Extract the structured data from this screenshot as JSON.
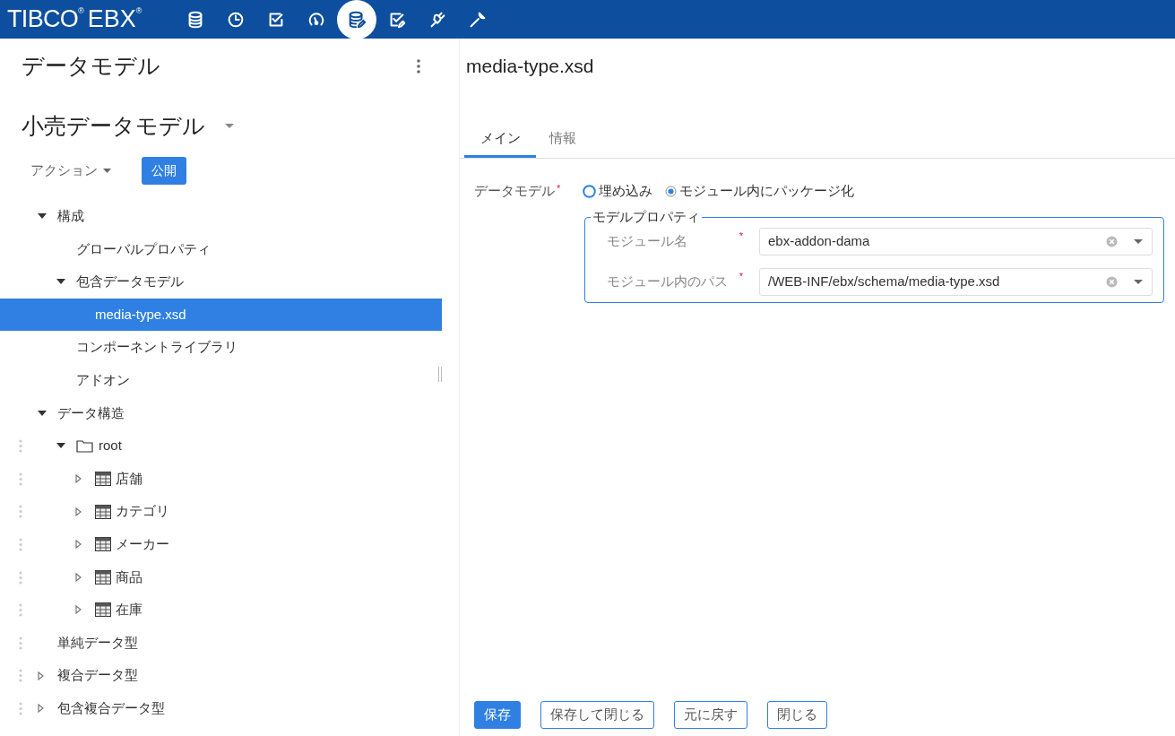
{
  "header": {
    "logo": "TIBCO",
    "logo_mark": "®",
    "product": "EBX",
    "product_mark": "®",
    "nav": [
      {
        "kind": "database",
        "selected": false
      },
      {
        "kind": "clock",
        "selected": false
      },
      {
        "kind": "checkbox",
        "selected": false
      },
      {
        "kind": "gauge",
        "selected": false
      },
      {
        "kind": "database-edit",
        "selected": true
      },
      {
        "kind": "check-edit",
        "selected": false
      },
      {
        "kind": "plug",
        "selected": false
      },
      {
        "kind": "wrench",
        "selected": false
      }
    ]
  },
  "sidebar": {
    "title": "データモデル",
    "model_name": "小売データモデル",
    "actions_label": "アクション",
    "publish_label": "公開",
    "tree": [
      {
        "label": "構成",
        "expanded": true,
        "handle": false,
        "children": [
          {
            "label": "グローバルプロパティ",
            "handle": false,
            "selected": false
          },
          {
            "label": "包含データモデル",
            "expanded": true,
            "handle": false,
            "children": [
              {
                "label": "media-type.xsd",
                "handle": false,
                "selected": true
              }
            ]
          },
          {
            "label": "コンポーネントライブラリ",
            "handle": false,
            "selected": false
          },
          {
            "label": "アドオン",
            "handle": false,
            "selected": false
          }
        ]
      },
      {
        "label": "データ構造",
        "expanded": true,
        "handle": false,
        "children": [
          {
            "label": "root",
            "kind": "folder",
            "expanded": true,
            "handle": true,
            "children": [
              {
                "label": "店舗",
                "kind": "table",
                "expanded": false,
                "handle": true
              },
              {
                "label": "カテゴリ",
                "kind": "table",
                "expanded": false,
                "handle": true
              },
              {
                "label": "メーカー",
                "kind": "table",
                "expanded": false,
                "handle": true
              },
              {
                "label": "商品",
                "kind": "table",
                "expanded": false,
                "handle": true
              },
              {
                "label": "在庫",
                "kind": "table",
                "expanded": false,
                "handle": true
              }
            ]
          }
        ]
      },
      {
        "label": "単純データ型",
        "handle": true,
        "selected": false
      },
      {
        "label": "複合データ型",
        "expanded": false,
        "handle": true
      },
      {
        "label": "包含複合データ型",
        "expanded": false,
        "handle": true
      }
    ]
  },
  "main": {
    "title": "media-type.xsd",
    "tabs": [
      {
        "label": "メイン",
        "selected": true
      },
      {
        "label": "情報",
        "selected": false
      }
    ],
    "data_model": {
      "label": "データモデル",
      "required_mark": "*",
      "options": [
        {
          "label": "埋め込み",
          "selected": false
        },
        {
          "label": "モジュール内にパッケージ化",
          "selected": true
        }
      ]
    },
    "group": {
      "legend": "モデルプロパティ",
      "fields": [
        {
          "label": "モジュール名",
          "required_mark": "*",
          "value": "ebx-addon-dama"
        },
        {
          "label": "モジュール内のパス",
          "required_mark": "*",
          "value": "/WEB-INF/ebx/schema/media-type.xsd"
        }
      ]
    },
    "buttons": [
      {
        "label": "保存",
        "kind": "primary"
      },
      {
        "label": "保存して閉じる",
        "kind": "secondary"
      },
      {
        "label": "元に戻す",
        "kind": "secondary"
      },
      {
        "label": "閉じる",
        "kind": "secondary"
      }
    ]
  }
}
